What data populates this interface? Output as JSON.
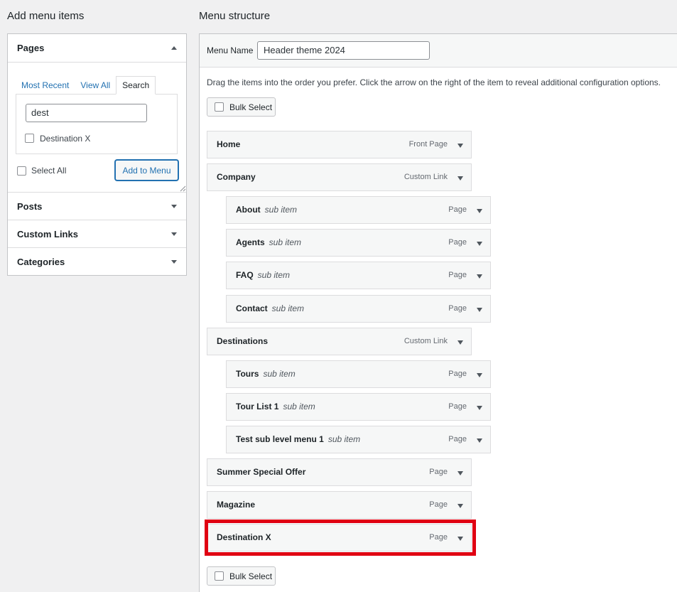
{
  "left": {
    "title": "Add menu items",
    "pages": {
      "label": "Pages",
      "tabs": [
        "Most Recent",
        "View All",
        "Search"
      ],
      "active_tab": "Search",
      "search_value": "dest",
      "result_label": "Destination X",
      "select_all_label": "Select All",
      "add_button": "Add to Menu"
    },
    "sections": [
      "Posts",
      "Custom Links",
      "Categories"
    ]
  },
  "right": {
    "title": "Menu structure",
    "menu_name_label": "Menu Name",
    "menu_name_value": "Header theme 2024",
    "instructions": "Drag the items into the order you prefer. Click the arrow on the right of the item to reveal additional configuration options.",
    "bulk_select": "Bulk Select",
    "sub_item_label": "sub item",
    "items": [
      {
        "title": "Home",
        "type": "Front Page",
        "depth": 0
      },
      {
        "title": "Company",
        "type": "Custom Link",
        "depth": 0
      },
      {
        "title": "About",
        "type": "Page",
        "depth": 1
      },
      {
        "title": "Agents",
        "type": "Page",
        "depth": 1
      },
      {
        "title": "FAQ",
        "type": "Page",
        "depth": 1
      },
      {
        "title": "Contact",
        "type": "Page",
        "depth": 1
      },
      {
        "title": "Destinations",
        "type": "Custom Link",
        "depth": 0
      },
      {
        "title": "Tours",
        "type": "Page",
        "depth": 1
      },
      {
        "title": "Tour List 1",
        "type": "Page",
        "depth": 1
      },
      {
        "title": "Test sub level menu 1",
        "type": "Page",
        "depth": 1
      },
      {
        "title": "Summer Special Offer",
        "type": "Page",
        "depth": 0
      },
      {
        "title": "Magazine",
        "type": "Page",
        "depth": 0
      },
      {
        "title": "Destination X",
        "type": "Page",
        "depth": 0
      }
    ]
  },
  "colors": {
    "highlight": "#e00012",
    "link": "#2271b1"
  }
}
